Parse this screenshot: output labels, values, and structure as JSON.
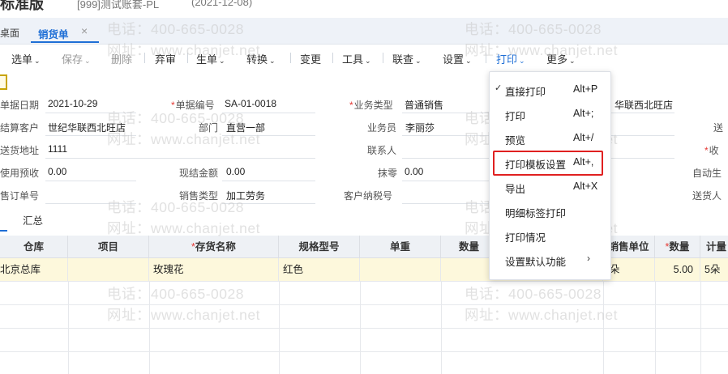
{
  "title_bar": {
    "edition": "标准版",
    "account": "[999]测试账套-PL",
    "date": "(2021-12-08)"
  },
  "tabs": {
    "desktop": "桌面",
    "active": "销货单",
    "close": "×"
  },
  "toolbar": {
    "select": "选单",
    "save": "保存",
    "delete": "删除",
    "approve": "弃审",
    "generate": "生单",
    "convert": "转换",
    "change": "变更",
    "tools": "工具",
    "query": "联查",
    "settings": "设置",
    "print": "打印",
    "more": "更多"
  },
  "form": {
    "doc_date_label": "单据日期",
    "doc_date": "2021-10-29",
    "doc_no_label": "单据编号",
    "doc_no": "SA-01-0018",
    "biz_type_label": "业务类型",
    "biz_type": "普通销售",
    "customer_right": "华联西北旺店",
    "settle_customer_label": "结算客户",
    "settle_customer": "世纪华联西北旺店",
    "dept_label": "部门",
    "dept": "直营一部",
    "salesman_label": "业务员",
    "salesman": "李丽莎",
    "right_label_1": "送",
    "ship_addr_label": "送货地址",
    "ship_addr": "1111",
    "contact_label": "联系人",
    "right_label_2": "收",
    "prepay_label": "使用预收",
    "prepay": "0.00",
    "cash_label": "现结金额",
    "cash": "0.00",
    "round_label": "抹零",
    "round": "0.00",
    "right_label_3": "自动生",
    "order_no_label": "售订单号",
    "sale_type_label": "销售类型",
    "sale_type": "加工劳务",
    "tax_no_label": "客户纳税号",
    "right_label_4": "送货人"
  },
  "detail_tabs": {
    "summary": "汇总"
  },
  "grid": {
    "headers": {
      "warehouse": "仓库",
      "project": "项目",
      "inventory": "存货名称",
      "spec": "规格型号",
      "unit_weight": "单重",
      "qty_partial": "数量",
      "sale_unit": "销售单位",
      "quantity": "数量",
      "unit_partial": "计量"
    },
    "row1": {
      "warehouse": "北京总库",
      "inventory": "玫瑰花",
      "spec": "红色",
      "sale_unit": "朵",
      "quantity": "5.00",
      "unit": "5朵"
    }
  },
  "print_menu": {
    "items": [
      {
        "label": "直接打印",
        "shortcut": "Alt+P",
        "checked": true
      },
      {
        "label": "打印",
        "shortcut": "Alt+;"
      },
      {
        "label": "预览",
        "shortcut": "Alt+/"
      },
      {
        "label": "打印模板设置",
        "shortcut": "Alt+,"
      },
      {
        "label": "导出",
        "shortcut": "Alt+X"
      },
      {
        "label": "明细标签打印"
      },
      {
        "label": "打印情况"
      },
      {
        "label": "设置默认功能"
      }
    ]
  },
  "watermark": {
    "phone": "电话：400-665-0028",
    "site": "网址：www.chanjet.net"
  },
  "colors": {
    "accent": "#1f6fd6",
    "highlight_row": "#fdf8dc",
    "red_box": "#e02020"
  }
}
